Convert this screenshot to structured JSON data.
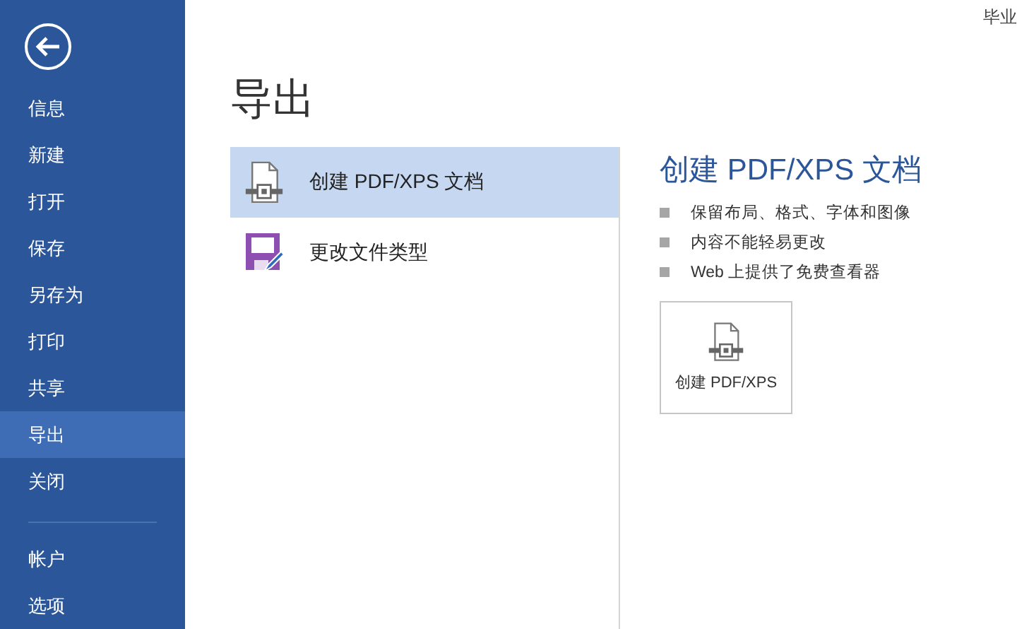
{
  "window": {
    "title": "毕业"
  },
  "sidebar": {
    "items": [
      {
        "label": "信息",
        "selected": false
      },
      {
        "label": "新建",
        "selected": false
      },
      {
        "label": "打开",
        "selected": false
      },
      {
        "label": "保存",
        "selected": false
      },
      {
        "label": "另存为",
        "selected": false
      },
      {
        "label": "打印",
        "selected": false
      },
      {
        "label": "共享",
        "selected": false
      },
      {
        "label": "导出",
        "selected": true
      },
      {
        "label": "关闭",
        "selected": false
      }
    ],
    "footer_items": [
      {
        "label": "帐户",
        "selected": false
      },
      {
        "label": "选项",
        "selected": false
      }
    ]
  },
  "page": {
    "title": "导出"
  },
  "export_options": [
    {
      "label": "创建 PDF/XPS 文档",
      "kind": "pdf",
      "selected": true
    },
    {
      "label": "更改文件类型",
      "kind": "filetype",
      "selected": false
    }
  ],
  "detail": {
    "title": "创建 PDF/XPS 文档",
    "bullets": [
      "保留布局、格式、字体和图像",
      "内容不能轻易更改",
      "Web 上提供了免费查看器"
    ],
    "action_button": {
      "label": "创建 PDF/XPS"
    }
  }
}
